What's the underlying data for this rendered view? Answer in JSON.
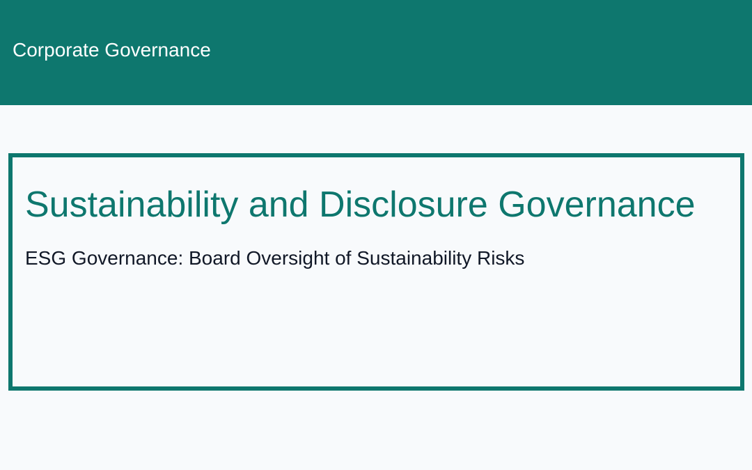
{
  "header": {
    "title": "Corporate Governance"
  },
  "card": {
    "title": "Sustainability and Disclosure Governance",
    "subtitle": "ESG Governance: Board Oversight of Sustainability Risks"
  },
  "colors": {
    "accent": "#0e776e",
    "background": "#f8fafc",
    "text": "#111827"
  }
}
